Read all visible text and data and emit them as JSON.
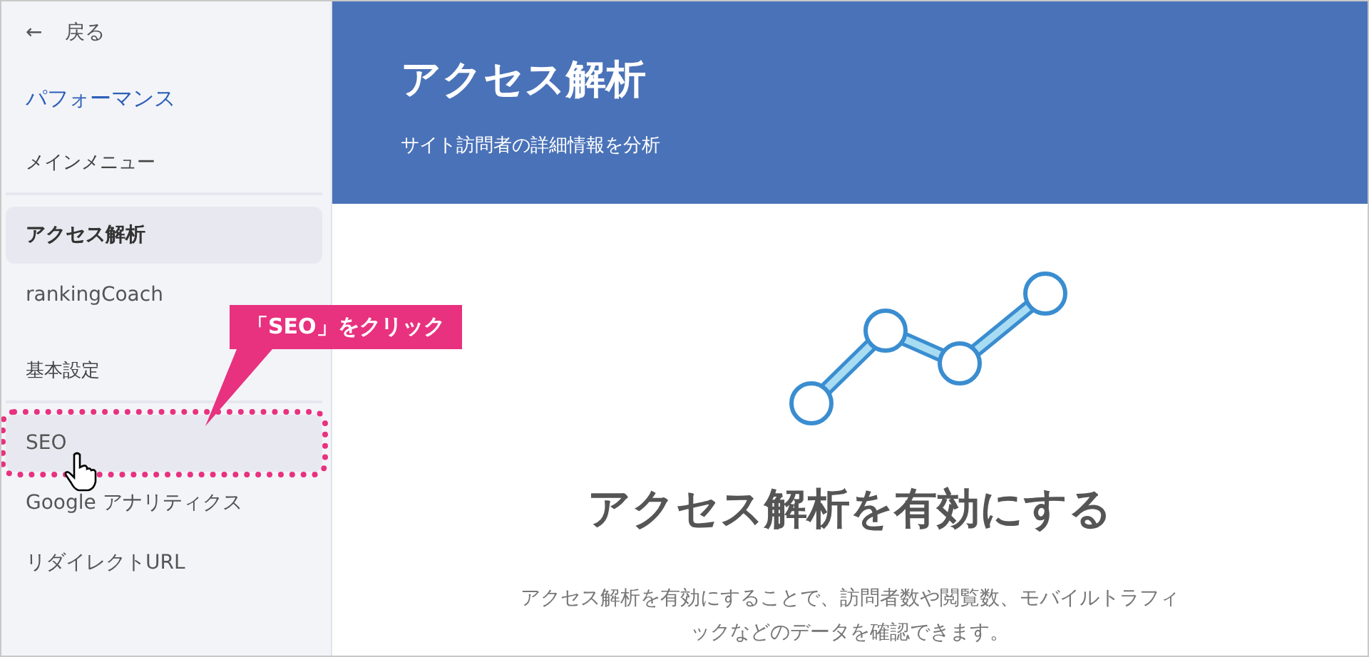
{
  "sidebar": {
    "back": {
      "icon": "←",
      "label": "戻る"
    },
    "title": "パフォーマンス",
    "sections": [
      {
        "heading": "メインメニュー",
        "items": [
          {
            "label": "アクセス解析",
            "selected": true,
            "hovered": false
          },
          {
            "label": "rankingCoach",
            "selected": false,
            "hovered": false
          }
        ]
      },
      {
        "heading": "基本設定",
        "items": [
          {
            "label": "SEO",
            "selected": false,
            "hovered": true
          },
          {
            "label": "Google アナリティクス",
            "selected": false,
            "hovered": false
          },
          {
            "label": "リダイレクトURL",
            "selected": false,
            "hovered": false
          }
        ]
      }
    ]
  },
  "header": {
    "title": "アクセス解析",
    "subtitle": "サイト訪問者の詳細情報を分析"
  },
  "empty_state": {
    "heading": "アクセス解析を有効にする",
    "description": "アクセス解析を有効にすることで、訪問者数や閲覧数、モバイルトラフィックなどのデータを確認できます。"
  },
  "annotation": {
    "callout": "「SEO」をクリック"
  }
}
